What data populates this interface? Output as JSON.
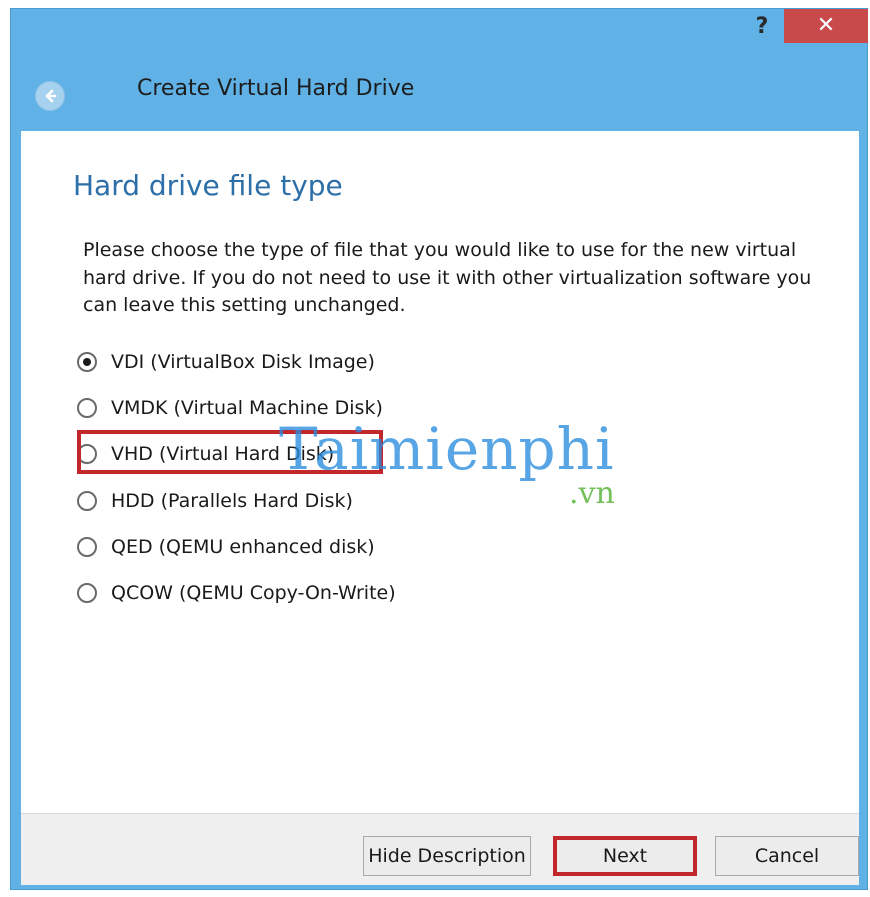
{
  "window": {
    "title": "Create Virtual Hard Drive",
    "help_glyph": "?",
    "close_glyph": "✕"
  },
  "page": {
    "heading": "Hard drive file type",
    "description": "Please choose the type of file that you would like to use for the new virtual hard drive. If you do not need to use it with other virtualization software you can leave this setting unchanged."
  },
  "options": [
    {
      "label": "VDI (VirtualBox Disk Image)",
      "checked": true
    },
    {
      "label": "VMDK (Virtual Machine Disk)",
      "checked": false
    },
    {
      "label": "VHD (Virtual Hard Disk)",
      "checked": false
    },
    {
      "label": "HDD (Parallels Hard Disk)",
      "checked": false
    },
    {
      "label": "QED (QEMU enhanced disk)",
      "checked": false
    },
    {
      "label": "QCOW (QEMU Copy-On-Write)",
      "checked": false
    }
  ],
  "buttons": {
    "hide_description": "Hide Description",
    "next": "Next",
    "cancel": "Cancel"
  },
  "watermark": {
    "main": "Taimienphi",
    "sub": ".vn"
  },
  "colors": {
    "titlebar": "#5fb1e6",
    "close": "#c84a4b",
    "heading": "#2d6fa8",
    "highlight": "#c1272d"
  }
}
